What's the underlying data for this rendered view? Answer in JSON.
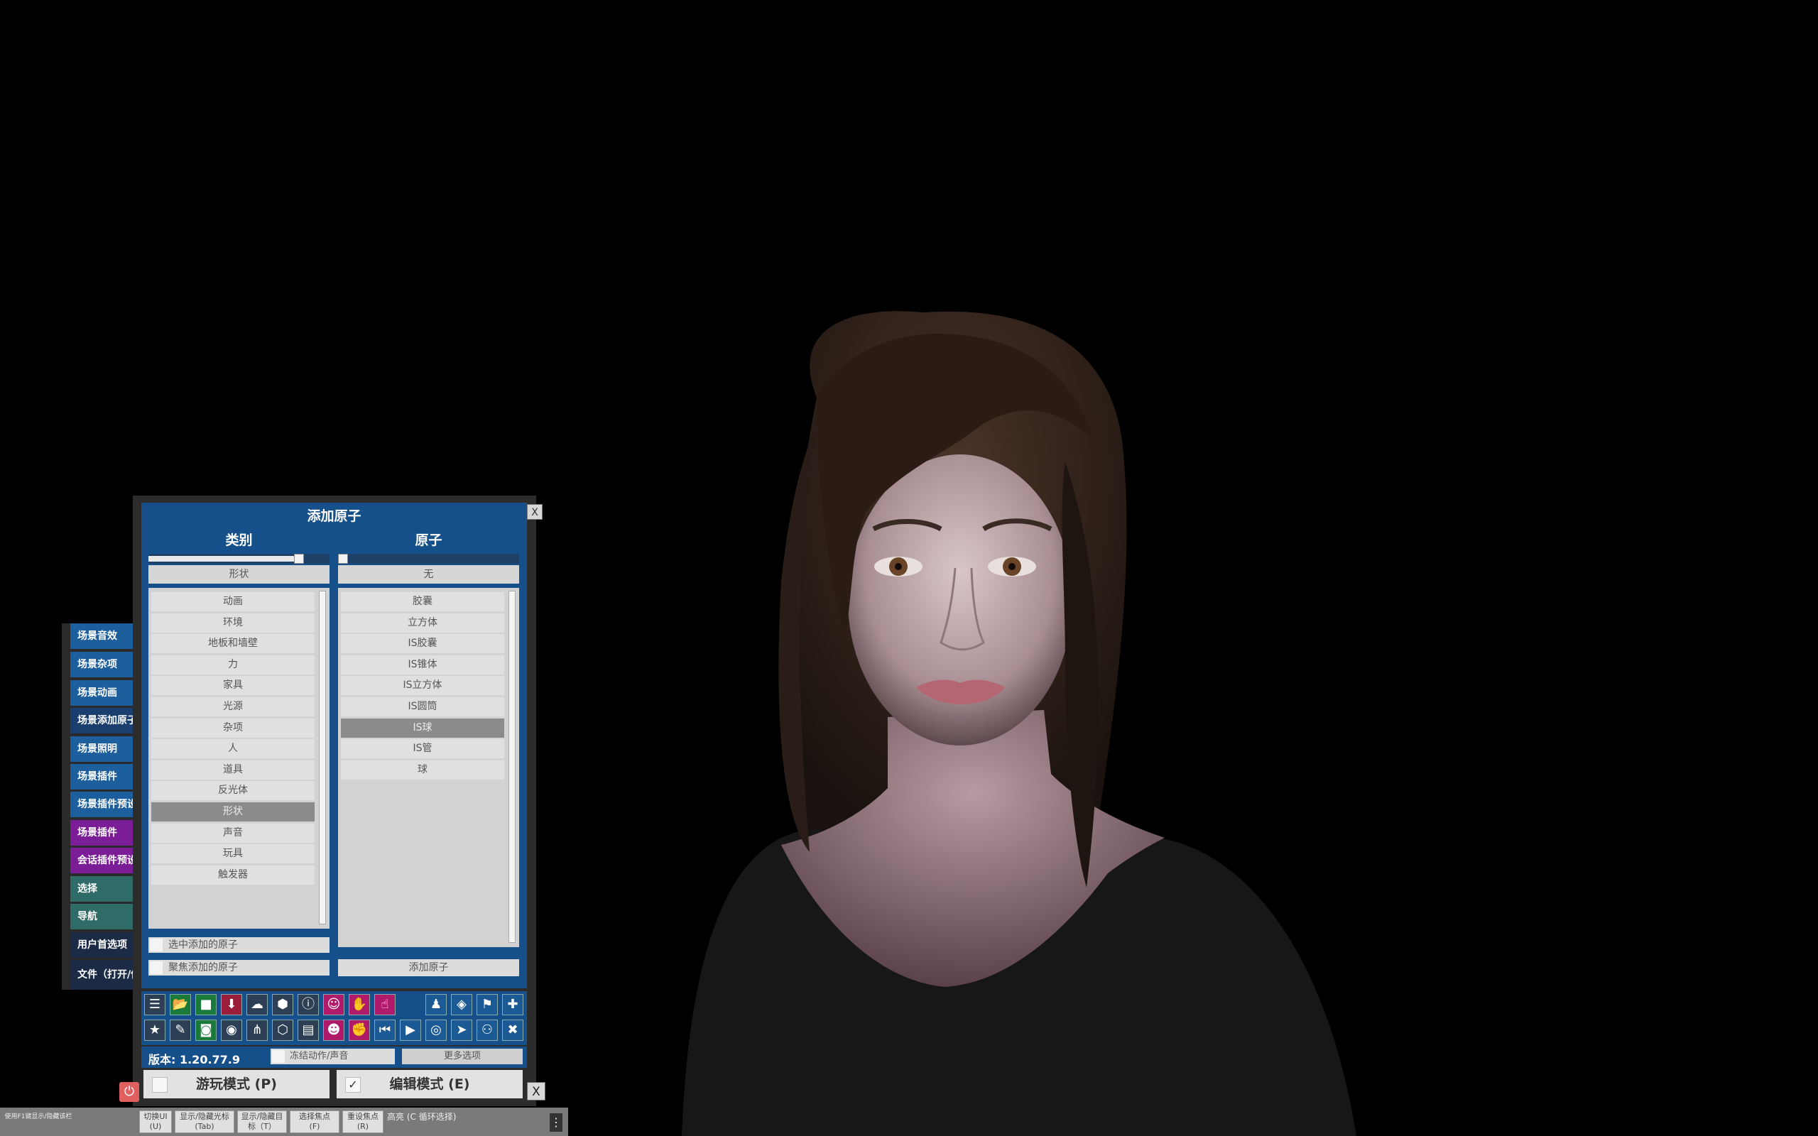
{
  "panel": {
    "title": "添加原子",
    "close": "X",
    "category_header": "类别",
    "atom_header": "原子",
    "category_scroll": 0.85,
    "atom_scroll": 0.0,
    "category_selected": "形状",
    "atom_selected": "无",
    "categories": [
      "动画",
      "环境",
      "地板和墙壁",
      "力",
      "家具",
      "光源",
      "杂项",
      "人",
      "道具",
      "反光体",
      "形状",
      "声音",
      "玩具",
      "触发器"
    ],
    "atoms": [
      "胶囊",
      "立方体",
      "IS胶囊",
      "IS锥体",
      "IS立方体",
      "IS圆筒",
      "IS球",
      "IS管",
      "球"
    ],
    "select_added_label": "选中添加的原子",
    "focus_added_label": "聚焦添加的原子",
    "add_atom_button": "添加原子"
  },
  "side_tabs": [
    {
      "label": "场景音效",
      "color": "blue"
    },
    {
      "label": "场景杂项",
      "color": "blue"
    },
    {
      "label": "场景动画",
      "color": "blue"
    },
    {
      "label": "场景添加原子",
      "color": "active"
    },
    {
      "label": "场景照明",
      "color": "blue"
    },
    {
      "label": "场景插件",
      "color": "blue"
    },
    {
      "label": "场景插件预设",
      "color": "blue"
    },
    {
      "label": "场景插件",
      "color": "purple"
    },
    {
      "label": "会话插件预设",
      "color": "purple"
    },
    {
      "label": "选择",
      "color": "green"
    },
    {
      "label": "导航",
      "color": "green"
    },
    {
      "label": "用户首选项",
      "color": "dark"
    },
    {
      "label": "文件（打开/保存）",
      "color": "dark"
    }
  ],
  "toolbar": {
    "row1": [
      "menu-icon",
      "open-folder-icon",
      "folder-icon",
      "save-icon",
      "cloud-download-icon",
      "box-icon",
      "info-icon",
      "person-settings-icon",
      "hand-icon",
      "pointer-hand-icon",
      "",
      "person-icon",
      "vr-headset-icon",
      "flag-icon",
      "plus-icon"
    ],
    "row2": [
      "star-icon",
      "edit-folder-icon",
      "camera-folder-icon",
      "camera-icon",
      "graph-icon",
      "package-icon",
      "document-icon",
      "person-edit-icon",
      "grab-hand-icon",
      "skip-back-icon",
      "play-icon",
      "target-icon",
      "cursor-icon",
      "people-icon",
      "tools-icon"
    ]
  },
  "version": "版本: 1.20.77.9",
  "freeze_label": "冻结动作/声音",
  "more_options": "更多选项",
  "play_mode": "游玩模式 (P)",
  "edit_mode": "编辑模式 (E)",
  "edit_check": "✓",
  "power": "⏻",
  "mode_close": "X",
  "hints": {
    "f1": "使用F1键显示/隐藏该栏",
    "keys": [
      {
        "line1": "切换UI",
        "line2": "(U)"
      },
      {
        "line1": "显示/隐藏光标",
        "line2": "(Tab)"
      },
      {
        "line1": "显示/隐藏目",
        "line2": "标（T）"
      },
      {
        "line1": "选择焦点",
        "line2": "(F)"
      },
      {
        "line1": "重设焦点",
        "line2": "(R)"
      }
    ],
    "highlight": "高亮 (C 循环选择)",
    "menu": "⋮"
  },
  "colors": {
    "panel_blue": "#15508a",
    "tab_blue": "#1d5f9c",
    "tab_purple": "#7a1d96",
    "tab_green": "#2f6b67",
    "selected_gray": "#8b8b8b"
  }
}
